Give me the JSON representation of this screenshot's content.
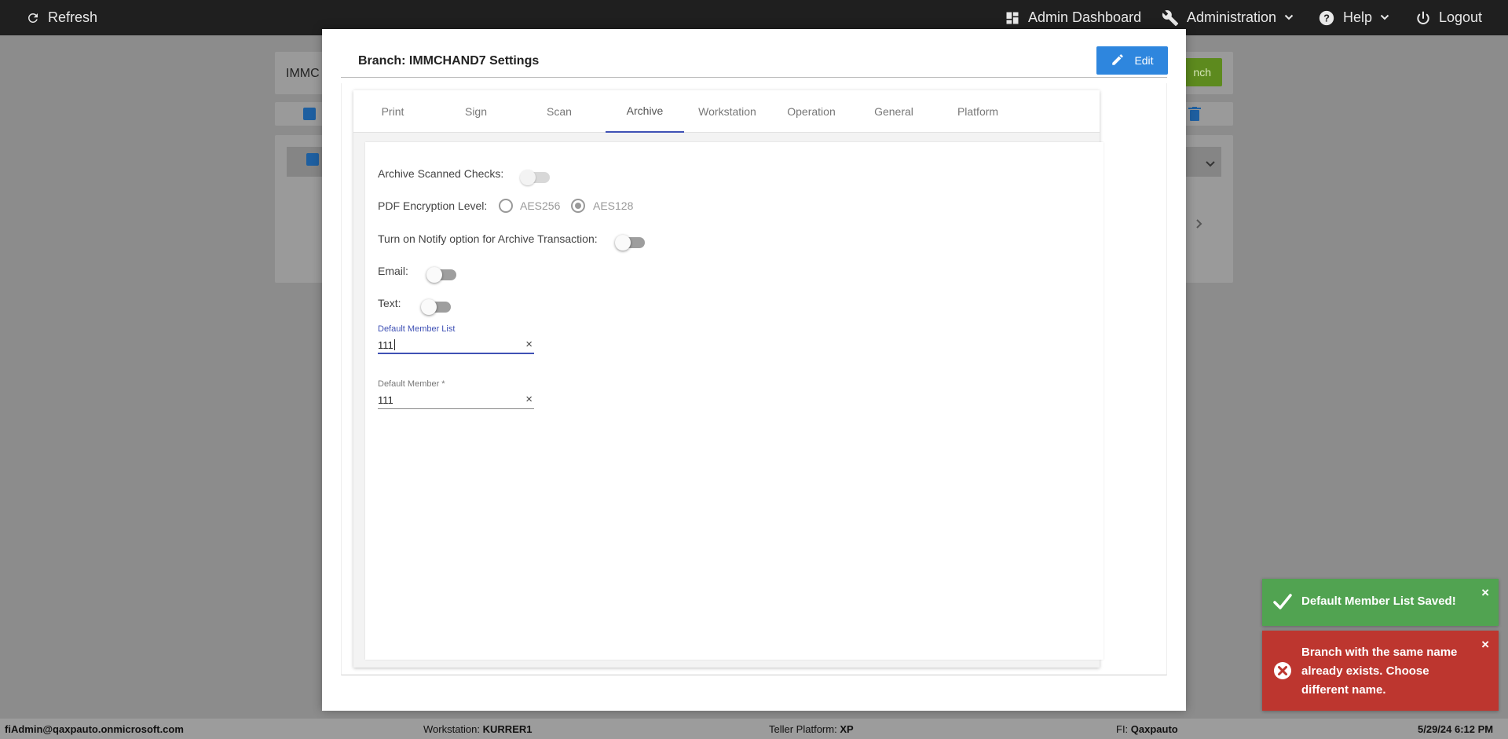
{
  "topbar": {
    "refresh_label": "Refresh",
    "admin_dashboard_label": "Admin Dashboard",
    "administration_label": "Administration",
    "help_label": "Help",
    "logout_label": "Logout"
  },
  "background": {
    "search_value_fragment": "IMMC",
    "add_button_fragment": "nch"
  },
  "modal": {
    "title": "Branch: IMMCHAND7 Settings",
    "edit_label": "Edit",
    "tabs": [
      {
        "label": "Print"
      },
      {
        "label": "Sign"
      },
      {
        "label": "Scan"
      },
      {
        "label": "Archive"
      },
      {
        "label": "Workstation"
      },
      {
        "label": "Operation"
      },
      {
        "label": "General"
      },
      {
        "label": "Platform"
      }
    ],
    "active_tab": "Archive",
    "archive": {
      "archive_scanned_checks_label": "Archive Scanned Checks:",
      "archive_scanned_checks_on": false,
      "pdf_encryption_label": "PDF Encryption Level:",
      "pdf_options": [
        "AES256",
        "AES128"
      ],
      "pdf_selected": "AES128",
      "notify_label": "Turn on Notify option for Archive Transaction:",
      "notify_on": false,
      "email_label": "Email:",
      "email_on": false,
      "text_label": "Text:",
      "text_on": false,
      "default_member_list_label": "Default Member List",
      "default_member_list_value": "111",
      "default_member_label": "Default Member *",
      "default_member_value": "111"
    }
  },
  "toasts": {
    "success_message": "Default Member List Saved!",
    "error_message": "Branch with the same name already exists. Choose different name.",
    "close_glyph": "×"
  },
  "footer": {
    "user": "fiAdmin@qaxpauto.onmicrosoft.com",
    "workstation_label": "Workstation:",
    "workstation_value": "KURRER1",
    "teller_platform_label": "Teller Platform:",
    "teller_platform_value": "XP",
    "fi_label": "FI:",
    "fi_value": "Qaxpauto",
    "datetime": "5/29/24 6:12 PM"
  },
  "colors": {
    "accent_blue": "#2e86de",
    "active_tab_underline": "#3f51b5",
    "success": "#51a351",
    "error": "#bd362f"
  }
}
